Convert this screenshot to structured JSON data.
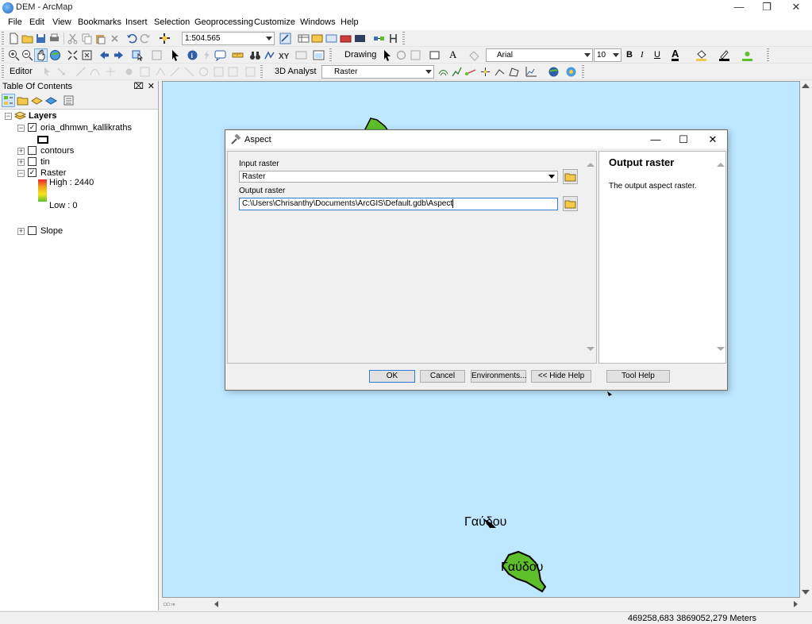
{
  "window": {
    "title": "DEM - ArcMap"
  },
  "menu": [
    "File",
    "Edit",
    "View",
    "Bookmarks",
    "Insert",
    "Selection",
    "Geoprocessing",
    "Customize",
    "Windows",
    "Help"
  ],
  "toolbar": {
    "scale": "1:504.565",
    "drawing_label": "Drawing",
    "font_name": "Arial",
    "font_size": "10",
    "bold": "B",
    "italic": "I",
    "underline": "U",
    "font_color_letter": "A",
    "text_letter": "A",
    "editor_label": "Editor",
    "analyst_label": "3D Analyst",
    "layer_combo": "Raster"
  },
  "toc": {
    "title": "Table Of Contents",
    "root": "Layers",
    "layers": [
      {
        "name": "oria_dhmwn_kallikraths",
        "checked": true
      },
      {
        "name": "contours",
        "checked": false
      },
      {
        "name": "tin",
        "checked": false
      },
      {
        "name": "Raster",
        "checked": true
      },
      {
        "name": "Slope",
        "checked": false
      }
    ],
    "legend_high": "High : 2440",
    "legend_low": "Low : 0"
  },
  "map": {
    "label_top": "Γαύδου",
    "label_bottom": "Γαύδου",
    "colors": {
      "water": "#bee8ff",
      "land": "#5dbf2a"
    }
  },
  "dialog": {
    "title": "Aspect",
    "input_label": "Input raster",
    "input_value": "Raster",
    "output_label": "Output raster",
    "output_value": "C:\\Users\\Chrisanthy\\Documents\\ArcGIS\\Default.gdb\\Aspect",
    "help_title": "Output raster",
    "help_text": "The output aspect raster.",
    "buttons": {
      "ok": "OK",
      "cancel": "Cancel",
      "env": "Environments...",
      "hide_help": "<< Hide Help",
      "tool_help": "Tool Help"
    }
  },
  "status": {
    "coords": "469258,683  3869052,279 Meters"
  }
}
